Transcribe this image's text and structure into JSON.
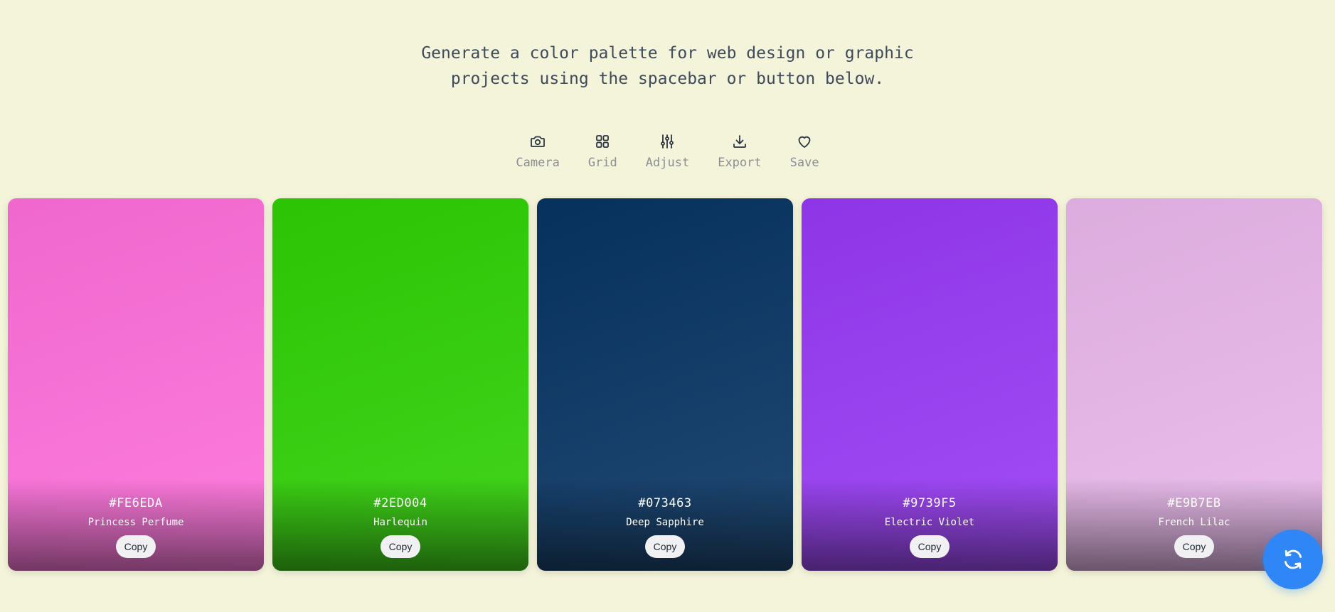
{
  "intro": {
    "line1": "Generate a color palette for web design or graphic",
    "line2": "projects using the spacebar or button below."
  },
  "toolbar": [
    {
      "label": "Camera",
      "icon": "camera-icon"
    },
    {
      "label": "Grid",
      "icon": "grid-icon"
    },
    {
      "label": "Adjust",
      "icon": "sliders-icon"
    },
    {
      "label": "Export",
      "icon": "download-icon"
    },
    {
      "label": "Save",
      "icon": "heart-icon"
    }
  ],
  "palette": [
    {
      "hex": "#FE6EDA",
      "name": "Princess Perfume",
      "color": "#FE6EDA",
      "copy_label": "Copy"
    },
    {
      "hex": "#2ED004",
      "name": "Harlequin",
      "color": "#2ED004",
      "copy_label": "Copy"
    },
    {
      "hex": "#073463",
      "name": "Deep Sapphire",
      "color": "#073463",
      "copy_label": "Copy"
    },
    {
      "hex": "#9739F5",
      "name": "Electric Violet",
      "color": "#9739F5",
      "copy_label": "Copy"
    },
    {
      "hex": "#E9B7EB",
      "name": "French Lilac",
      "color": "#E9B7EB",
      "copy_label": "Copy"
    }
  ],
  "fab": {
    "icon": "refresh-icon",
    "color": "#2F86F6"
  },
  "colors": {
    "background": "#F4F4DA",
    "text": "#3F4A5A",
    "muted": "#8B8F94"
  }
}
